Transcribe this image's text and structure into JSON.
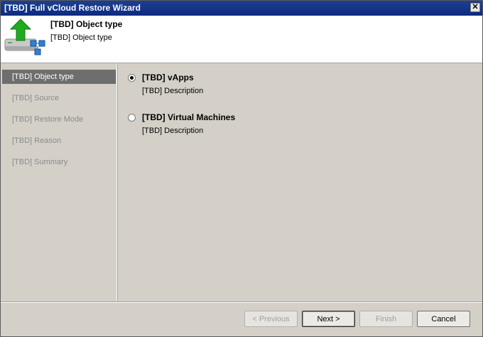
{
  "window": {
    "title": "[TBD] Full vCloud Restore Wizard",
    "close_glyph": "✕"
  },
  "header": {
    "title": "[TBD] Object type",
    "subtitle": "[TBD] Object type",
    "icon": "restore-server-icon"
  },
  "steps": [
    {
      "label": "[TBD] Object type",
      "active": true
    },
    {
      "label": "[TBD] Source",
      "active": false
    },
    {
      "label": "[TBD] Restore Mode",
      "active": false
    },
    {
      "label": "[TBD] Reason",
      "active": false
    },
    {
      "label": "[TBD] Summary",
      "active": false
    }
  ],
  "options": [
    {
      "label": "[TBD] vApps",
      "description": "[TBD] Description",
      "selected": true
    },
    {
      "label": "[TBD] Virtual Machines",
      "description": "[TBD] Description",
      "selected": false
    }
  ],
  "buttons": {
    "previous": "< Previous",
    "next": "Next >",
    "finish": "Finish",
    "cancel": "Cancel"
  },
  "colors": {
    "titlebar": "#0c2a80",
    "active_step": "#6e6e6e",
    "arrow": "#1faa1f"
  }
}
